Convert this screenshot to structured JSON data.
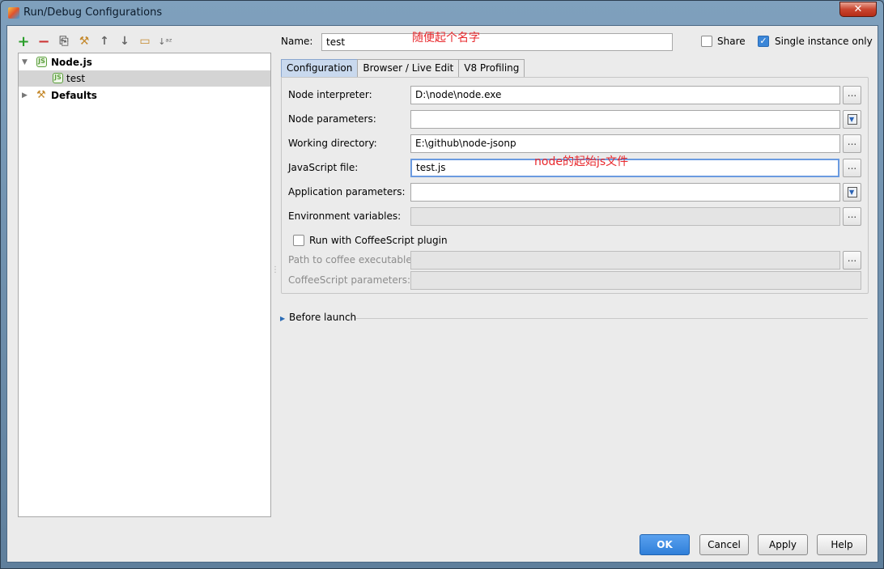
{
  "window": {
    "title": "Run/Debug Configurations",
    "close_label": "✕"
  },
  "toolbar": {
    "icons": [
      "add-icon",
      "remove-icon",
      "copy-icon",
      "edit-defaults-icon",
      "move-up-icon",
      "move-down-icon",
      "folder-icon",
      "sort-icon"
    ],
    "glyphs": {
      "add": "+",
      "remove": "−",
      "copy": "⎘",
      "edit": "⚒",
      "up": "↑",
      "down": "↓",
      "folder": "▭",
      "sort": "↓ᵃᶻ"
    }
  },
  "tree": {
    "nodejs_label": "Node.js",
    "test_label": "test",
    "defaults_label": "Defaults",
    "node_icon_glyph": "JS",
    "wrench_glyph": "⚒",
    "expanded_arrow": "▼",
    "collapsed_arrow": "▶"
  },
  "name": {
    "label": "Name:",
    "value": "test",
    "annotation": "随便起个名字"
  },
  "share": {
    "label": "Share",
    "checked": false
  },
  "single_instance": {
    "label": "Single instance only",
    "checked": true,
    "check_glyph": "✓"
  },
  "tabs": [
    "Configuration",
    "Browser / Live Edit",
    "V8 Profiling"
  ],
  "form": {
    "node_interpreter": {
      "label": "Node interpreter:",
      "value": "D:\\node\\node.exe"
    },
    "node_parameters": {
      "label": "Node parameters:",
      "value": ""
    },
    "working_directory": {
      "label": "Working directory:",
      "value": "E:\\github\\node-jsonp"
    },
    "javascript_file": {
      "label": "JavaScript file:",
      "value": "test.js",
      "annotation": "node的起始js文件"
    },
    "application_parameters": {
      "label": "Application parameters:",
      "value": ""
    },
    "environment_variables": {
      "label": "Environment variables:",
      "value": ""
    },
    "run_with_coffeescript": {
      "label": "Run with CoffeeScript plugin",
      "checked": false
    },
    "path_to_coffee": {
      "label": "Path to coffee executable:",
      "value": ""
    },
    "coffeescript_parameters": {
      "label": "CoffeeScript parameters:",
      "value": ""
    },
    "browse_label": "..."
  },
  "before_launch": {
    "label": "Before launch",
    "arrow": "▶"
  },
  "buttons": {
    "ok": "OK",
    "cancel": "Cancel",
    "apply": "Apply",
    "help": "Help"
  },
  "colors": {
    "accent": "#3b86d8",
    "annotation": "#e8272b",
    "tree_selection": "#d4d4d4"
  }
}
